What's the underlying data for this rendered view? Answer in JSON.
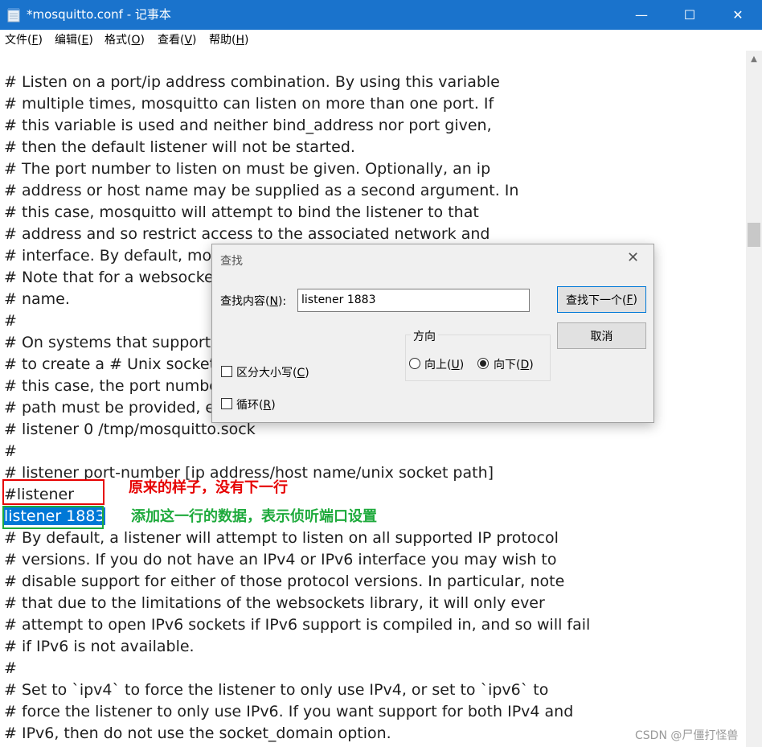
{
  "window": {
    "title": "*mosquitto.conf - 记事本",
    "minimize": "—",
    "maximize": "☐",
    "close": "✕"
  },
  "menu": {
    "file": {
      "pre": "文件(",
      "key": "F",
      "post": ")"
    },
    "edit": {
      "pre": "编辑(",
      "key": "E",
      "post": ")"
    },
    "format": {
      "pre": "格式(",
      "key": "O",
      "post": ")"
    },
    "view": {
      "pre": "查看(",
      "key": "V",
      "post": ")"
    },
    "help": {
      "pre": "帮助(",
      "key": "H",
      "post": ")"
    }
  },
  "editor": {
    "lines": [
      "# Listen on a port/ip address combination. By using this variable",
      "# multiple times, mosquitto can listen on more than one port. If",
      "# this variable is used and neither bind_address nor port given,",
      "# then the default listener will not be started.",
      "# The port number to listen on must be given. Optionally, an ip",
      "# address or host name may be supplied as a second argument. In",
      "# this case, mosquitto will attempt to bind the listener to that",
      "# address and so restrict access to the associated network and",
      "# interface. By default, mosquitto will listen on all interfaces.",
      "# Note that for a websockets listener it is not possible to bind to a host",
      "# name.",
      "#",
      "# On systems that support Unix Domain Sockets, it is also possible",
      "# to create a # Unix socket rather than opening a TCP socket. In",
      "# this case, the port number should be set to 0 and a unix socket",
      "# path must be provided, e.g.",
      "# listener 0 /tmp/mosquitto.sock",
      "#",
      "# listener port-number [ip address/host name/unix socket path]",
      "#listener",
      "listener 1883",
      "# By default, a listener will attempt to listen on all supported IP protocol",
      "# versions. If you do not have an IPv4 or IPv6 interface you may wish to",
      "# disable support for either of those protocol versions. In particular, note",
      "# that due to the limitations of the websockets library, it will only ever",
      "# attempt to open IPv6 sockets if IPv6 support is compiled in, and so will fail",
      "# if IPv6 is not available.",
      "#",
      "# Set to `ipv4` to force the listener to only use IPv4, or set to `ipv6` to",
      "# force the listener to only use IPv6. If you want support for both IPv4 and",
      "# IPv6, then do not use the socket_domain option."
    ],
    "selected_text": "listener 1883"
  },
  "annotations": {
    "original": {
      "text": "原来的样子，没有下一行",
      "color": "#e60000"
    },
    "added": {
      "text": "添加这一行的数据，表示侦听端口设置",
      "color": "#1eaa3c"
    }
  },
  "find_dialog": {
    "title": "查找",
    "close": "✕",
    "find_what": {
      "pre": "查找内容(",
      "key": "N",
      "post": "):"
    },
    "value": "listener 1883",
    "find_next": {
      "pre": "查找下一个(",
      "key": "F",
      "post": ")"
    },
    "cancel": "取消",
    "direction_title": "方向",
    "up": {
      "pre": "向上(",
      "key": "U",
      "post": ")"
    },
    "down": {
      "pre": "向下(",
      "key": "D",
      "post": ")"
    },
    "match_case": {
      "pre": "区分大小写(",
      "key": "C",
      "post": ")"
    },
    "wrap": {
      "pre": "循环(",
      "key": "R",
      "post": ")"
    },
    "direction_selected": "down"
  },
  "watermark": "CSDN @尸僵打怪兽"
}
